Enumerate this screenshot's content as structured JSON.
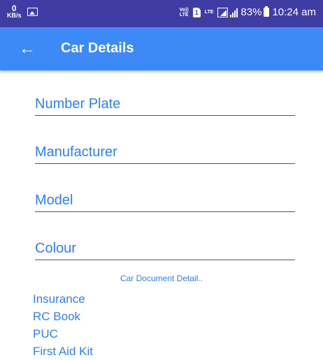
{
  "status_bar": {
    "net_speed_value": "0",
    "net_speed_unit": "KB/s",
    "volte_top": "Vo))",
    "volte_bottom": "LTE",
    "sim_label": "1",
    "lte_label": "LTE",
    "battery_percent": "83%",
    "time": "10:24 am"
  },
  "app_bar": {
    "back_icon": "←",
    "title": "Car Details"
  },
  "form": {
    "number_plate_placeholder": "Number Plate",
    "manufacturer_placeholder": "Manufacturer",
    "model_placeholder": "Model",
    "colour_placeholder": "Colour"
  },
  "documents": {
    "section_label": "Car Document Detail..",
    "items": [
      "Insurance",
      "RC Book",
      "PUC",
      "First Aid Kit"
    ]
  },
  "colors": {
    "status_bar": "#3f3da3",
    "app_bar": "#3d8af7",
    "accent_text": "#2f80ec"
  }
}
